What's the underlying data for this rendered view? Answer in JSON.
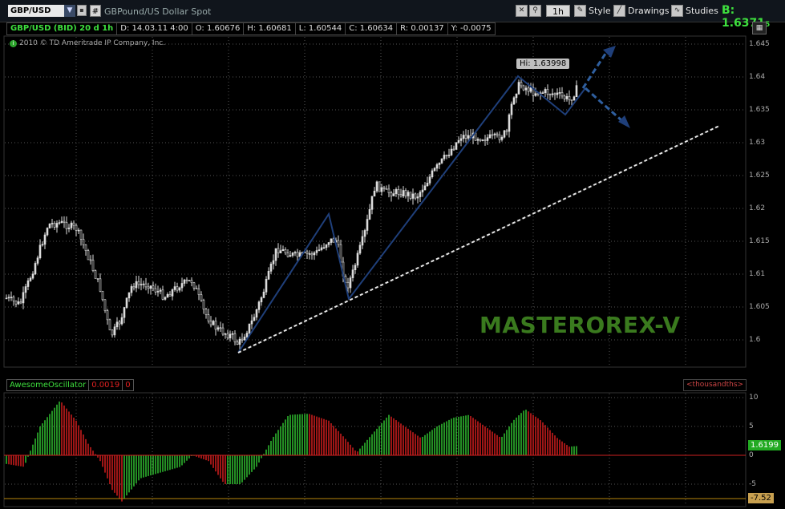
{
  "toolbar": {
    "symbol": "GBP/USD",
    "description": "GBPound/US Dollar Spot",
    "timeframe": "1h",
    "style_label": "Style",
    "drawings_label": "Drawings",
    "studies_label": "Studies",
    "bid_label": "B: 1.6371",
    "bid_sub": "5",
    "hash_label": "#"
  },
  "info": {
    "symbol_period": "GBP/USD (BID) 20 d 1h",
    "date": "D: 14.03.11 4:00",
    "open": "O: 1.60676",
    "high": "H: 1.60681",
    "low": "L: 1.60544",
    "close": "C: 1.60634",
    "range": "R: 0.00137",
    "y": "Y: -0.0075"
  },
  "copyright": "2010 © TD Ameritrade IP Company, Inc.",
  "hi_label": "Hi: 1.63998",
  "watermark": "MASTEROREX-V",
  "price_axis": [
    "1.645",
    "1.64",
    "1.635",
    "1.63",
    "1.625",
    "1.62",
    "1.615",
    "1.61",
    "1.605",
    "1.6"
  ],
  "oscillator": {
    "name": "AwesomeOscillator",
    "value": "0.0019",
    "second": "0",
    "units": "<thousandths>",
    "axis": [
      "10",
      "5",
      "0",
      "-5"
    ],
    "tag_high": "1.6199",
    "tag_low": "-7.52"
  },
  "colors": {
    "up": "#33cc33",
    "down": "#e02020",
    "trend_line": "#1f3f7a",
    "arrow": "#2f5f9f",
    "watermark": "#3a7a1e"
  }
}
